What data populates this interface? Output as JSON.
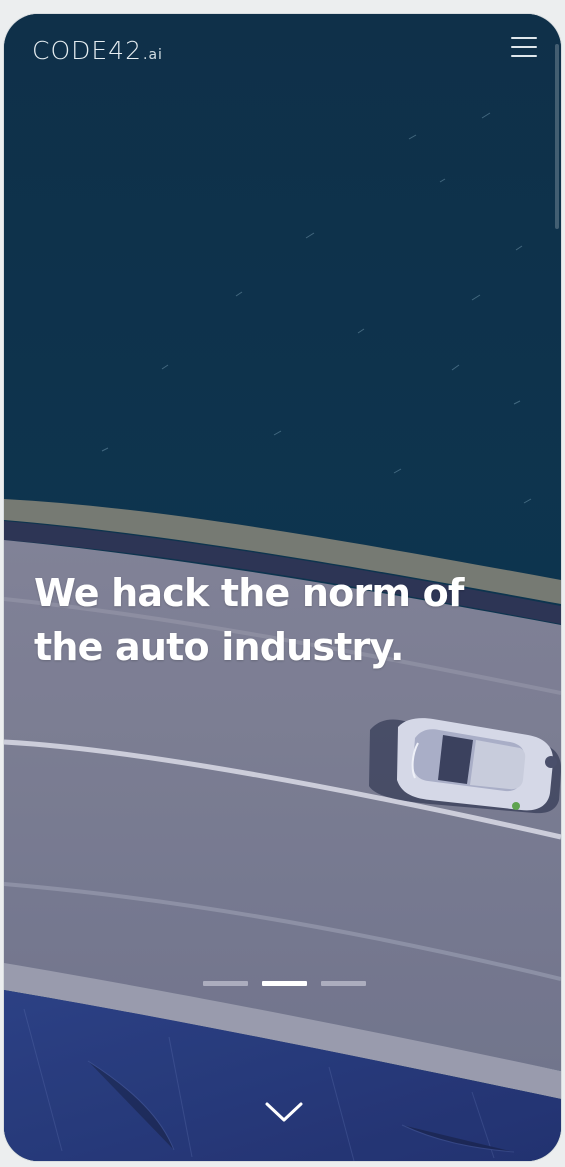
{
  "app": {
    "logo_main": "CODE42",
    "logo_suffix": ".ai"
  },
  "hero": {
    "headline_line1": "We hack the norm of",
    "headline_line2": "the auto industry.",
    "active_slide": 2,
    "slide_count": 3
  },
  "icons": {
    "menu": "hamburger-menu-icon",
    "scroll_down": "chevron-down-icon"
  },
  "colors": {
    "sea": "#072f47",
    "road": "#7e8196",
    "overlay": "#4b4f78",
    "text": "#ffffff"
  }
}
